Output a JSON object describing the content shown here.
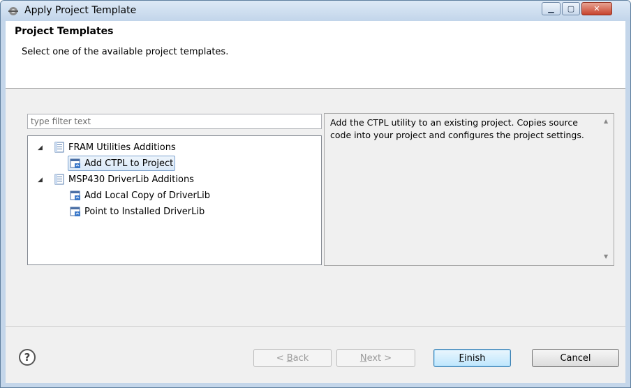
{
  "window": {
    "title": "Apply Project Template"
  },
  "header": {
    "title": "Project Templates",
    "description": "Select one of the available project templates."
  },
  "filter": {
    "placeholder": "type filter text",
    "value": ""
  },
  "tree": {
    "groups": [
      {
        "label": "FRAM Utilities Additions",
        "expanded": true,
        "items": [
          {
            "label": "Add CTPL to Project",
            "selected": true
          }
        ]
      },
      {
        "label": "MSP430 DriverLib Additions",
        "expanded": true,
        "items": [
          {
            "label": "Add Local Copy of DriverLib",
            "selected": false
          },
          {
            "label": "Point to Installed DriverLib",
            "selected": false
          }
        ]
      }
    ]
  },
  "details": {
    "text": "Add the CTPL utility to an existing project. Copies source code into your project and configures the project settings."
  },
  "buttons": {
    "back": {
      "prefix": "< ",
      "mnemonic": "B",
      "rest": "ack",
      "enabled": false
    },
    "next": {
      "mnemonic": "N",
      "rest": "ext >",
      "enabled": false
    },
    "finish": {
      "mnemonic": "F",
      "rest": "inish",
      "enabled": true
    },
    "cancel": {
      "label": "Cancel",
      "enabled": true
    }
  },
  "help": {
    "glyph": "?"
  },
  "colors": {
    "selection_border": "#7da2ce",
    "default_button_border": "#3c7fb1",
    "titlebar": "#c4d6ea"
  }
}
